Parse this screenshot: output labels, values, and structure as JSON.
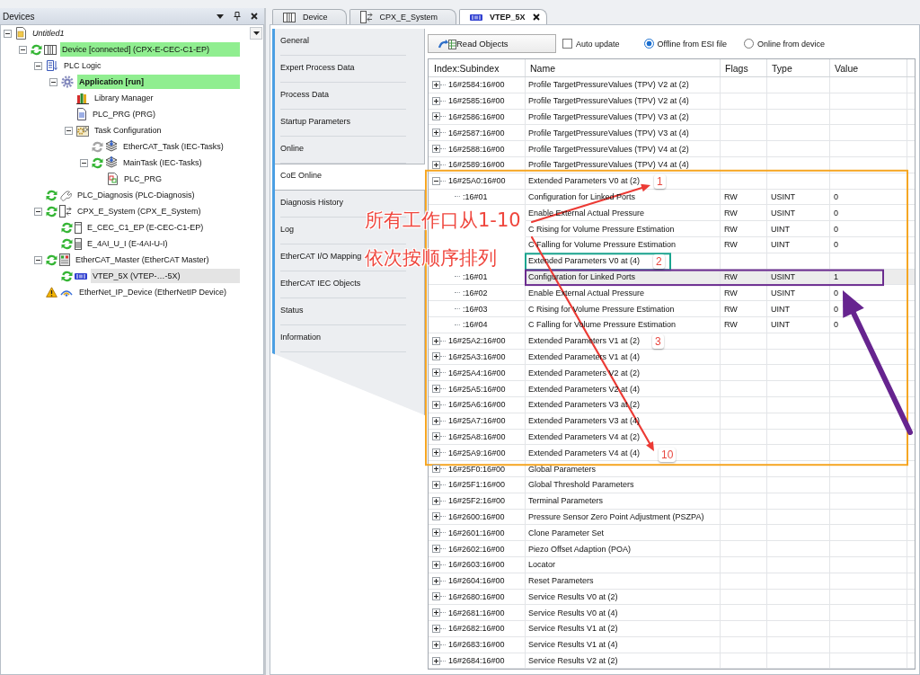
{
  "devices_panel": {
    "title": "Devices",
    "tree": [
      {
        "label": "Untitled1",
        "kind": "project",
        "online": false,
        "selected": false,
        "expanded": true,
        "children": [
          {
            "label": "Device [connected] (CPX-E-CEC-C1-EP)",
            "kind": "device",
            "running": true,
            "warning": false,
            "online": true,
            "selected": false,
            "expanded": true,
            "children": [
              {
                "label": "PLC Logic",
                "kind": "logic",
                "online": false,
                "selected": false,
                "expanded": true,
                "children": [
                  {
                    "label": "Application [run]",
                    "kind": "application",
                    "online": true,
                    "selected": false,
                    "expanded": true,
                    "children": [
                      {
                        "label": "Library Manager",
                        "kind": "library",
                        "online": false,
                        "selected": false
                      },
                      {
                        "label": "PLC_PRG (PRG)",
                        "kind": "program",
                        "online": false,
                        "selected": false
                      },
                      {
                        "label": "Task Configuration",
                        "kind": "task_config",
                        "online": false,
                        "selected": false,
                        "expanded": true,
                        "children": [
                          {
                            "label": "EtherCAT_Task (IEC-Tasks)",
                            "kind": "task",
                            "running": false,
                            "warning": false,
                            "online": false,
                            "selected": false
                          },
                          {
                            "label": "MainTask (IEC-Tasks)",
                            "kind": "task",
                            "running": true,
                            "warning": false,
                            "online": false,
                            "selected": false,
                            "expanded": true,
                            "children": [
                              {
                                "label": "PLC_PRG",
                                "kind": "call",
                                "online": false,
                                "selected": false
                              }
                            ]
                          }
                        ]
                      }
                    ]
                  }
                ]
              },
              {
                "label": "PLC_Diagnosis (PLC-Diagnosis)",
                "kind": "diagnosis",
                "running": true,
                "warning": false,
                "online": false,
                "selected": false
              },
              {
                "label": "CPX_E_System (CPX_E_System)",
                "kind": "system",
                "running": true,
                "warning": false,
                "online": false,
                "selected": false,
                "expanded": true,
                "children": [
                  {
                    "label": "E_CEC_C1_EP (E-CEC-C1-EP)",
                    "kind": "module",
                    "running": true,
                    "warning": false,
                    "online": false,
                    "selected": false
                  },
                  {
                    "label": "E_4AI_U_I (E-4AI-U-I)",
                    "kind": "io_module",
                    "running": true,
                    "warning": false,
                    "online": false,
                    "selected": false
                  }
                ]
              },
              {
                "label": "EtherCAT_Master (EtherCAT Master)",
                "kind": "master",
                "running": true,
                "warning": false,
                "online": false,
                "selected": false,
                "expanded": true,
                "children": [
                  {
                    "label": "VTEP_5X (VTEP-…-5X)",
                    "kind": "slave",
                    "running": true,
                    "warning": false,
                    "online": false,
                    "selected": true
                  }
                ]
              },
              {
                "label": "EtherNet_IP_Device (EtherNetIP Device)",
                "kind": "adapter",
                "warning": true,
                "online": false,
                "selected": false
              }
            ]
          }
        ]
      }
    ]
  },
  "editor_tabs": [
    {
      "label": "Device",
      "kind": "device",
      "selected": false
    },
    {
      "label": "CPX_E_System",
      "kind": "system",
      "selected": false
    },
    {
      "label": "VTEP_5X",
      "kind": "slave",
      "selected": true
    }
  ],
  "side_tabs": [
    {
      "label": "General",
      "selected": false
    },
    {
      "label": "Expert Process Data",
      "selected": false
    },
    {
      "label": "Process Data",
      "selected": false
    },
    {
      "label": "Startup Parameters",
      "selected": false
    },
    {
      "label": "Online",
      "selected": false
    },
    {
      "label": "CoE Online",
      "selected": true
    },
    {
      "label": "Diagnosis History",
      "selected": false
    },
    {
      "label": "Log",
      "selected": false
    },
    {
      "label": "EtherCAT I/O Mapping",
      "selected": false
    },
    {
      "label": "EtherCAT IEC Objects",
      "selected": false
    },
    {
      "label": "Status",
      "selected": false
    },
    {
      "label": "Information",
      "selected": false
    }
  ],
  "toolbar": {
    "read_button": "Read Objects",
    "auto_update": {
      "label": "Auto update",
      "checked": false
    },
    "source": [
      {
        "label": "Offline from ESI file",
        "selected": true
      },
      {
        "label": "Online from device",
        "selected": false
      }
    ]
  },
  "table": {
    "columns": [
      "Index:Subindex",
      "Name",
      "Flags",
      "Type",
      "Value"
    ],
    "rows": [
      {
        "index": "16#2584:16#00",
        "name": "Profile TargetPressureValues (TPV) V2 at (2)",
        "expanded": false,
        "selected": false
      },
      {
        "index": "16#2585:16#00",
        "name": "Profile TargetPressureValues (TPV) V2 at (4)",
        "expanded": false,
        "selected": false
      },
      {
        "index": "16#2586:16#00",
        "name": "Profile TargetPressureValues (TPV) V3 at (2)",
        "expanded": false,
        "selected": false
      },
      {
        "index": "16#2587:16#00",
        "name": "Profile TargetPressureValues (TPV) V3 at (4)",
        "expanded": false,
        "selected": false
      },
      {
        "index": "16#2588:16#00",
        "name": "Profile TargetPressureValues (TPV) V4 at (2)",
        "expanded": false,
        "selected": false
      },
      {
        "index": "16#2589:16#00",
        "name": "Profile TargetPressureValues (TPV) V4 at (4)",
        "expanded": false,
        "selected": false
      },
      {
        "index": "16#25A0:16#00",
        "name": "Extended Parameters V0 at (2)",
        "expanded": true,
        "selected": false,
        "children": [
          {
            "index": ":16#01",
            "name": "Configuration for Linked Ports",
            "flags": "RW",
            "type": "USINT",
            "value": "0",
            "selected": false
          },
          {
            "name": "Enable External Actual Pressure",
            "flags": "RW",
            "type": "USINT",
            "value": "0",
            "selected": false
          },
          {
            "name": "C Rising for Volume Pressure Estimation",
            "flags": "RW",
            "type": "UINT",
            "value": "0",
            "selected": false
          },
          {
            "name": "C Falling for Volume Pressure Estimation",
            "flags": "RW",
            "type": "UINT",
            "value": "0",
            "selected": false
          }
        ]
      },
      {
        "name": "Extended Parameters V0 at (4)",
        "selected": false,
        "children": [
          {
            "index": ":16#01",
            "name": "Configuration for Linked Ports",
            "flags": "RW",
            "type": "USINT",
            "value": "1",
            "selected": true
          },
          {
            "index": ":16#02",
            "name": "Enable External Actual Pressure",
            "flags": "RW",
            "type": "USINT",
            "value": "0",
            "selected": false
          },
          {
            "index": ":16#03",
            "name": "C Rising for Volume Pressure Estimation",
            "flags": "RW",
            "type": "UINT",
            "value": "0",
            "selected": false
          },
          {
            "index": ":16#04",
            "name": "C Falling for Volume Pressure Estimation",
            "flags": "RW",
            "type": "UINT",
            "value": "0",
            "selected": false
          }
        ]
      },
      {
        "index": "16#25A2:16#00",
        "name": "Extended Parameters V1 at (2)",
        "expanded": false,
        "selected": false
      },
      {
        "index": "16#25A3:16#00",
        "name": "Extended Parameters V1 at (4)",
        "expanded": false,
        "selected": false
      },
      {
        "index": "16#25A4:16#00",
        "name": "Extended Parameters V2 at (2)",
        "expanded": false,
        "selected": false
      },
      {
        "index": "16#25A5:16#00",
        "name": "Extended Parameters V2 at (4)",
        "expanded": false,
        "selected": false
      },
      {
        "index": "16#25A6:16#00",
        "name": "Extended Parameters V3 at (2)",
        "expanded": false,
        "selected": false
      },
      {
        "index": "16#25A7:16#00",
        "name": "Extended Parameters V3 at (4)",
        "expanded": false,
        "selected": false
      },
      {
        "index": "16#25A8:16#00",
        "name": "Extended Parameters V4 at (2)",
        "expanded": false,
        "selected": false
      },
      {
        "index": "16#25A9:16#00",
        "name": "Extended Parameters V4 at (4)",
        "expanded": false,
        "selected": false
      },
      {
        "index": "16#25F0:16#00",
        "name": "Global Parameters",
        "expanded": false,
        "selected": false
      },
      {
        "index": "16#25F1:16#00",
        "name": "Global Threshold Parameters",
        "expanded": false,
        "selected": false
      },
      {
        "index": "16#25F2:16#00",
        "name": "Terminal Parameters",
        "expanded": false,
        "selected": false
      },
      {
        "index": "16#2600:16#00",
        "name": "Pressure Sensor Zero Point Adjustment (PSZPA)",
        "expanded": false,
        "selected": false
      },
      {
        "index": "16#2601:16#00",
        "name": "Clone Parameter Set",
        "expanded": false,
        "selected": false
      },
      {
        "index": "16#2602:16#00",
        "name": "Piezo Offset Adaption (POA)",
        "expanded": false,
        "selected": false
      },
      {
        "index": "16#2603:16#00",
        "name": "Locator",
        "expanded": false,
        "selected": false
      },
      {
        "index": "16#2604:16#00",
        "name": "Reset Parameters",
        "expanded": false,
        "selected": false
      },
      {
        "index": "16#2680:16#00",
        "name": "Service Results V0 at (2)",
        "expanded": false,
        "selected": false
      },
      {
        "index": "16#2681:16#00",
        "name": "Service Results V0 at (4)",
        "expanded": false,
        "selected": false
      },
      {
        "index": "16#2682:16#00",
        "name": "Service Results V1 at (2)",
        "expanded": false,
        "selected": false
      },
      {
        "index": "16#2683:16#00",
        "name": "Service Results V1 at (4)",
        "expanded": false,
        "selected": false
      },
      {
        "index": "16#2684:16#00",
        "name": "Service Results V2 at (2)",
        "expanded": false,
        "selected": false
      }
    ]
  },
  "annotations": {
    "note_lines": [
      "所有工作口从1-10",
      "依次按顺序排列"
    ],
    "step_numbers": [
      "1",
      "2",
      "3",
      "10"
    ]
  }
}
